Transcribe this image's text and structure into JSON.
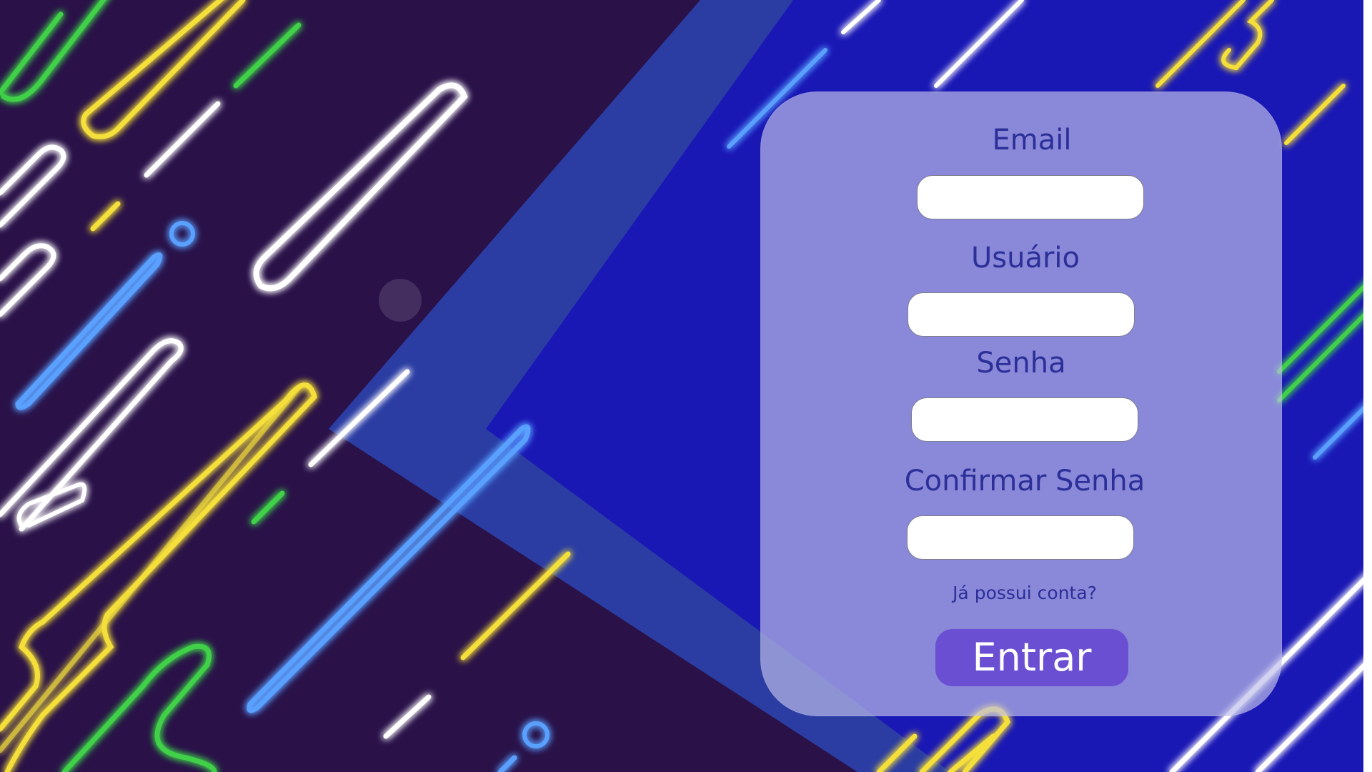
{
  "form": {
    "email_label": "Email",
    "email_value": "",
    "username_label": "Usuário",
    "username_value": "",
    "password_label": "Senha",
    "password_value": "",
    "confirm_password_label": "Confirmar Senha",
    "confirm_password_value": "",
    "login_link_text": "Já possui conta?",
    "submit_label": "Entrar"
  },
  "theme": {
    "page_background": "#2a1249",
    "panel_blue": "#1a18b5",
    "band_blue": "#2b3da3",
    "card_tint": "#bebeeb",
    "label_color": "#2b2f97",
    "button_color": "#6a4fd3",
    "button_text_color": "#ffffff"
  }
}
